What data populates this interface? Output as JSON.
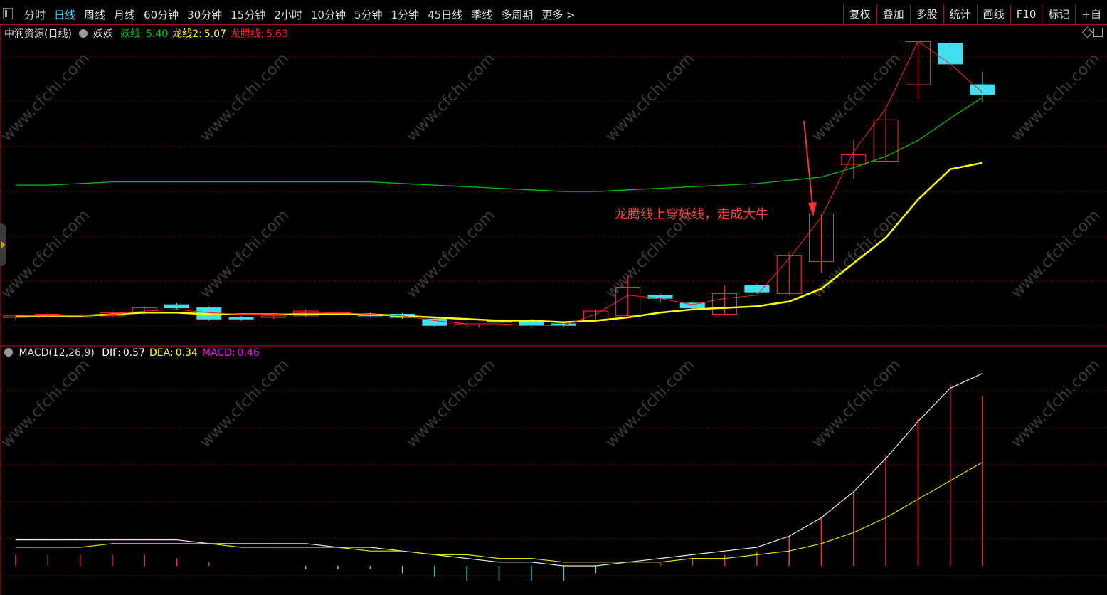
{
  "toolbar": {
    "periods": [
      "分时",
      "日线",
      "周线",
      "月线",
      "60分钟",
      "30分钟",
      "15分钟",
      "2小时",
      "10分钟",
      "5分钟",
      "1分钟",
      "45日线",
      "季线",
      "多周期",
      "更多 >"
    ],
    "active_period": "日线",
    "tools": [
      "复权",
      "叠加",
      "多股",
      "统计",
      "画线",
      "F10",
      "标记",
      "+自"
    ]
  },
  "main_panel": {
    "stock": "中润资源(日线)",
    "indicator": "妖妖",
    "lines": [
      {
        "label": "妖线:",
        "value": "5.40",
        "color": "#00d000"
      },
      {
        "label": "龙线2:",
        "value": "5.07",
        "color": "#ffff00"
      },
      {
        "label": "龙腾线:",
        "value": "5.63",
        "color": "#ff2020"
      }
    ],
    "annotation": "龙腾线上穿妖线，走成大牛"
  },
  "macd_panel": {
    "name": "MACD(12,26,9)",
    "lines": [
      {
        "label": "DIF:",
        "value": "0.57",
        "color": "#ffffff"
      },
      {
        "label": "DEA:",
        "value": "0.34",
        "color": "#ffff00"
      },
      {
        "label": "MACD:",
        "value": "0.46",
        "color": "#ff00ff"
      }
    ]
  },
  "watermark": "www.cfchi.com",
  "colors": {
    "up": "#ff3030",
    "down": "#40e0f0",
    "grid": "#7a0000",
    "yao": "#00c000",
    "long2": "#ffff00",
    "longteng": "#ff2020"
  },
  "chart_data": {
    "type": "candlestick",
    "candles": [
      [
        4.99,
        5.0,
        5.01,
        4.97
      ],
      [
        5.0,
        5.01,
        5.02,
        4.99
      ],
      [
        5.0,
        5.0,
        5.01,
        4.99
      ],
      [
        5.0,
        5.02,
        5.03,
        4.99
      ],
      [
        5.02,
        5.05,
        5.06,
        5.01
      ],
      [
        5.07,
        5.05,
        5.08,
        5.04
      ],
      [
        5.05,
        4.98,
        5.06,
        4.97
      ],
      [
        4.99,
        4.98,
        5.0,
        4.97
      ],
      [
        4.99,
        5.0,
        5.01,
        4.98
      ],
      [
        5.0,
        5.03,
        5.04,
        4.99
      ],
      [
        5.02,
        5.02,
        5.03,
        5.01
      ],
      [
        5.01,
        5.0,
        5.02,
        4.99
      ],
      [
        5.01,
        4.99,
        5.02,
        4.98
      ],
      [
        4.98,
        4.94,
        4.99,
        4.93
      ],
      [
        4.93,
        4.95,
        4.96,
        4.92
      ],
      [
        4.97,
        4.96,
        4.98,
        4.95
      ],
      [
        4.97,
        4.94,
        4.98,
        4.93
      ],
      [
        4.95,
        4.94,
        4.96,
        4.93
      ],
      [
        4.97,
        5.03,
        5.04,
        4.96
      ],
      [
        5.0,
        5.18,
        5.25,
        5.0
      ],
      [
        5.13,
        5.11,
        5.14,
        5.08
      ],
      [
        5.08,
        5.05,
        5.09,
        5.04
      ],
      [
        5.01,
        5.14,
        5.19,
        5.01
      ],
      [
        5.19,
        5.15,
        5.2,
        5.14
      ],
      [
        5.14,
        5.38,
        5.4,
        5.13
      ],
      [
        5.34,
        5.64,
        5.64,
        5.27
      ],
      [
        5.95,
        6.01,
        6.1,
        5.86
      ],
      [
        5.97,
        6.23,
        6.3,
        5.97
      ],
      [
        6.45,
        6.72,
        6.74,
        6.36
      ],
      [
        6.71,
        6.58,
        7.26,
        6.54
      ],
      [
        6.45,
        6.39,
        6.53,
        6.34
      ]
    ],
    "yao_line": [
      5.82,
      5.82,
      5.83,
      5.84,
      5.84,
      5.84,
      5.84,
      5.84,
      5.84,
      5.84,
      5.84,
      5.84,
      5.83,
      5.82,
      5.81,
      5.8,
      5.79,
      5.78,
      5.78,
      5.79,
      5.8,
      5.81,
      5.82,
      5.83,
      5.85,
      5.87,
      5.93,
      6.0,
      6.1,
      6.24,
      6.37
    ],
    "long2_line": [
      5.0,
      5.0,
      5.0,
      5.01,
      5.02,
      5.02,
      5.01,
      5.01,
      5.01,
      5.01,
      5.01,
      5.01,
      5.0,
      4.99,
      4.98,
      4.97,
      4.97,
      4.96,
      4.97,
      4.99,
      5.02,
      5.04,
      5.05,
      5.06,
      5.09,
      5.17,
      5.33,
      5.49,
      5.73,
      5.92,
      5.96
    ],
    "longteng_line": [
      5.0,
      5.0,
      5.0,
      5.01,
      5.03,
      5.04,
      5.02,
      5.01,
      5.01,
      5.02,
      5.02,
      5.01,
      5.0,
      4.97,
      4.95,
      4.95,
      4.94,
      4.94,
      5.01,
      5.13,
      5.11,
      5.07,
      5.11,
      5.13,
      5.36,
      5.62,
      6.03,
      6.3,
      6.74,
      6.58,
      6.4
    ],
    "macd": {
      "dif": [
        0.07,
        0.07,
        0.07,
        0.07,
        0.07,
        0.07,
        0.06,
        0.06,
        0.06,
        0.06,
        0.05,
        0.05,
        0.04,
        0.03,
        0.02,
        0.01,
        0.01,
        0.0,
        0.0,
        0.01,
        0.02,
        0.03,
        0.04,
        0.05,
        0.08,
        0.13,
        0.2,
        0.29,
        0.39,
        0.48,
        0.52
      ],
      "dea": [
        0.05,
        0.05,
        0.05,
        0.06,
        0.06,
        0.06,
        0.06,
        0.05,
        0.05,
        0.05,
        0.05,
        0.04,
        0.04,
        0.03,
        0.03,
        0.02,
        0.02,
        0.01,
        0.01,
        0.01,
        0.01,
        0.02,
        0.02,
        0.03,
        0.04,
        0.06,
        0.09,
        0.13,
        0.18,
        0.23,
        0.28
      ],
      "hist": [
        0.03,
        0.03,
        0.03,
        0.03,
        0.03,
        0.02,
        0.01,
        0.0,
        0.0,
        -0.01,
        -0.01,
        -0.01,
        -0.02,
        -0.03,
        -0.04,
        -0.04,
        -0.04,
        -0.04,
        -0.02,
        0.0,
        0.01,
        0.02,
        0.03,
        0.04,
        0.08,
        0.13,
        0.2,
        0.3,
        0.4,
        0.49,
        0.46
      ]
    }
  }
}
